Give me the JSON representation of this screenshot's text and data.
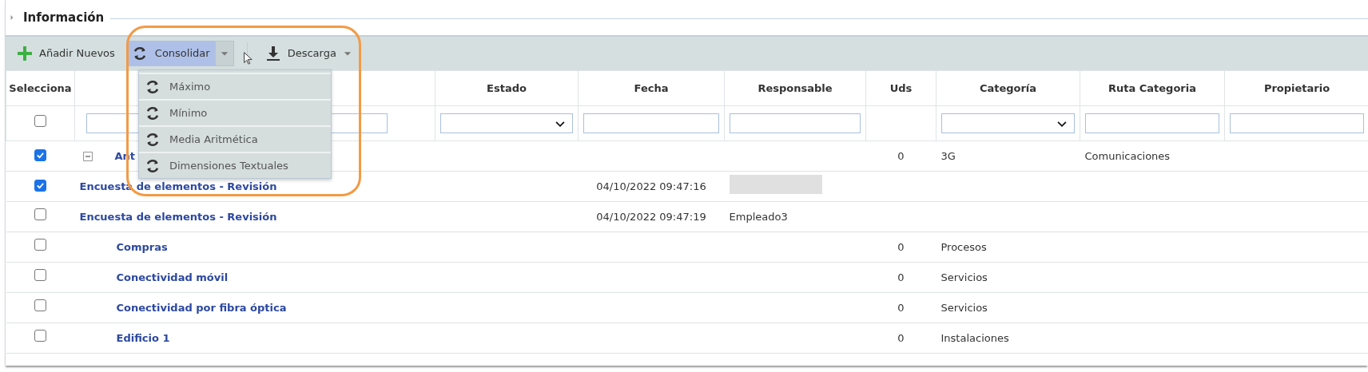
{
  "section": {
    "title": "Información",
    "expanded": false
  },
  "toolbar": [
    {
      "kind": "add",
      "label": "Añadir Nuevos"
    },
    {
      "kind": "split",
      "label": "Consolidar",
      "selected": true
    },
    {
      "kind": "download",
      "label": "Descarga"
    }
  ],
  "menu": {
    "items": [
      {
        "label": "Máximo"
      },
      {
        "label": "Mínimo"
      },
      {
        "label": "Media Aritmética"
      },
      {
        "label": "Dimensiones Textuales"
      }
    ]
  },
  "table": {
    "columns": [
      {
        "label": "Selecciona"
      },
      {},
      {
        "label": "Estado"
      },
      {
        "label": "Fecha"
      },
      {
        "label": "Responsable"
      },
      {
        "label": "Uds"
      },
      {
        "label": "Categoría"
      },
      {
        "label": "Ruta Categoria"
      },
      {
        "label": "Propietario"
      }
    ],
    "filters": [
      {
        "kind": "checkbox"
      },
      {
        "kind": "text"
      },
      {
        "kind": "select"
      },
      {
        "kind": "text"
      },
      {
        "kind": "text"
      },
      {
        "kind": "none"
      },
      {
        "kind": "select"
      },
      {
        "kind": "text"
      },
      {
        "kind": "text"
      }
    ],
    "filter_checked": false,
    "rows": [
      {
        "kind": "group",
        "expanded": true,
        "checked": true,
        "name": "Ant",
        "fecha": "",
        "responsable": "",
        "uds": "0",
        "categoria": "3G",
        "ruta": "Comunicaciones"
      },
      {
        "kind": "survey",
        "checked": true,
        "name": "Encuesta de elementos - Revisión",
        "fecha": "04/10/2022 09:47:16",
        "responsable": "",
        "redacted": true,
        "uds": "",
        "categoria": "",
        "ruta": ""
      },
      {
        "kind": "survey",
        "checked": false,
        "name": "Encuesta de elementos - Revisión",
        "fecha": "04/10/2022 09:47:19",
        "responsable": "Empleado3",
        "uds": "",
        "categoria": "",
        "ruta": ""
      },
      {
        "kind": "item",
        "checked": false,
        "name": "Compras",
        "fecha": "",
        "responsable": "",
        "uds": "0",
        "categoria": "Procesos",
        "ruta": ""
      },
      {
        "kind": "item",
        "checked": false,
        "name": "Conectividad móvil",
        "fecha": "",
        "responsable": "",
        "uds": "0",
        "categoria": "Servicios",
        "ruta": ""
      },
      {
        "kind": "item",
        "checked": false,
        "name": "Conectividad por fibra óptica",
        "fecha": "",
        "responsable": "",
        "uds": "0",
        "categoria": "Servicios",
        "ruta": ""
      },
      {
        "kind": "item",
        "checked": false,
        "name": "Edificio 1",
        "fecha": "",
        "responsable": "",
        "uds": "0",
        "categoria": "Instalaciones",
        "ruta": ""
      }
    ]
  }
}
